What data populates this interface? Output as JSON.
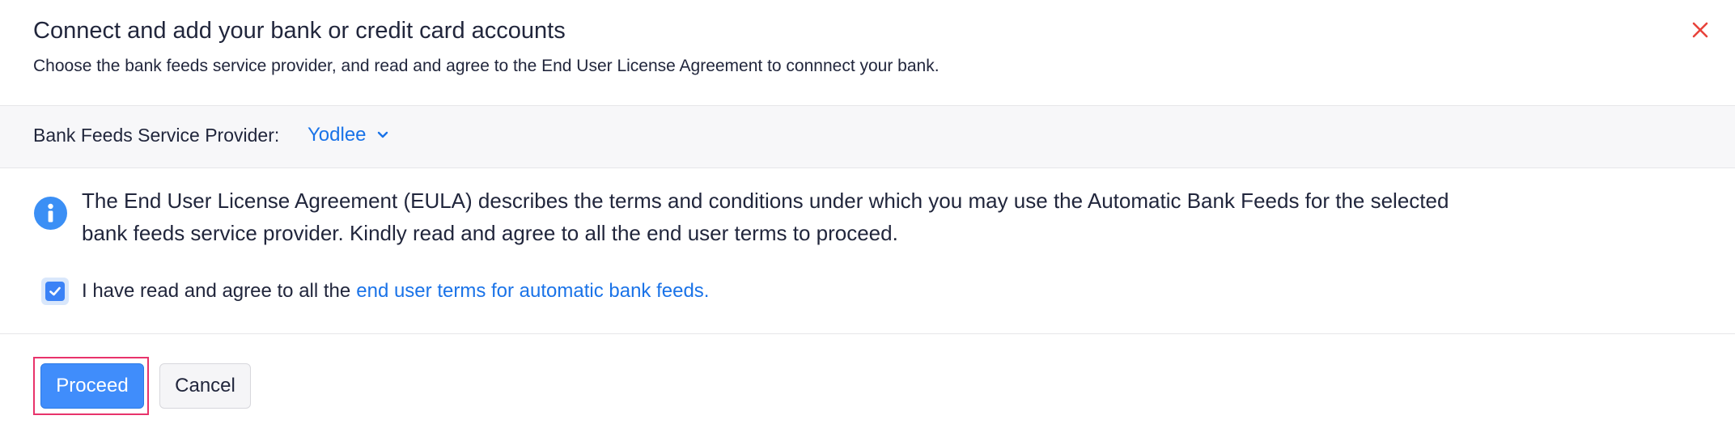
{
  "dialog": {
    "title": "Connect and add your bank or credit card accounts",
    "subtitle": "Choose the bank feeds service provider, and read and agree to the End User License Agreement to connnect your bank.",
    "close_icon": "close-icon"
  },
  "provider": {
    "label": "Bank Feeds Service Provider:",
    "selected": "Yodlee",
    "dropdown_icon": "chevron-down-icon"
  },
  "eula": {
    "info_icon": "info-icon",
    "text": "The End User License Agreement (EULA) describes the terms and conditions under which you may use the Automatic Bank Feeds for the selected bank feeds service provider. Kindly read and agree to all the end user terms to proceed."
  },
  "agreement": {
    "checked": true,
    "text": "I have read and agree to all the",
    "link_text": "end user terms for automatic bank feeds."
  },
  "actions": {
    "proceed_label": "Proceed",
    "cancel_label": "Cancel"
  },
  "colors": {
    "accent": "#408dfb",
    "link": "#1a73e8",
    "close": "#e8433b",
    "highlight": "#e8336b"
  }
}
